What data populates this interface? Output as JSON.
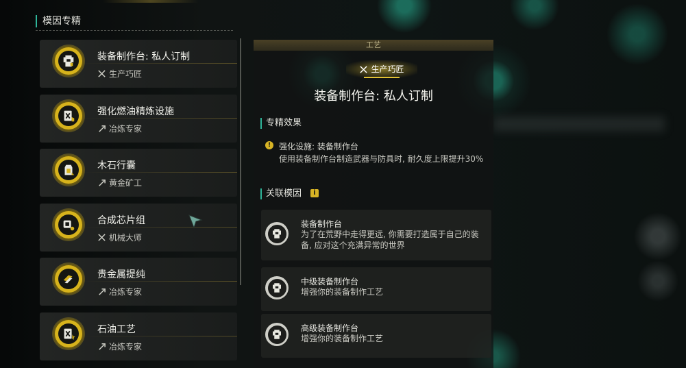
{
  "left_panel": {
    "title": "模因专精",
    "items": [
      {
        "name": "装备制作台: 私人订制",
        "category": "生产巧匠",
        "category_icon": "tools-icon",
        "item_icon": "workbench-icon"
      },
      {
        "name": "强化燃油精炼设施",
        "category": "冶炼专家",
        "category_icon": "pickaxe-icon",
        "item_icon": "fuel-icon"
      },
      {
        "name": "木石行囊",
        "category": "黄金矿工",
        "category_icon": "pickaxe-icon",
        "item_icon": "backpack-icon"
      },
      {
        "name": "合成芯片组",
        "category": "机械大师",
        "category_icon": "tools-icon",
        "item_icon": "chip-icon"
      },
      {
        "name": "贵金属提纯",
        "category": "冶炼专家",
        "category_icon": "pickaxe-icon",
        "item_icon": "ingot-icon"
      },
      {
        "name": "石油工艺",
        "category": "冶炼专家",
        "category_icon": "pickaxe-icon",
        "item_icon": "fuel-icon"
      }
    ]
  },
  "detail": {
    "header": "工艺",
    "badge": "生产巧匠",
    "title": "装备制作台: 私人订制",
    "effects_title": "专精效果",
    "effect_name": "强化设施: 装备制作台",
    "effect_desc": "使用装备制作台制造武器与防具时, 耐久度上限提升30%",
    "related_title": "关联模因",
    "related": [
      {
        "name": "装备制作台",
        "desc": "为了在荒野中走得更远, 你需要打造属于自己的装备, 应对这个充满异常的世界"
      },
      {
        "name": "中级装备制作台",
        "desc": "增强你的装备制作工艺"
      },
      {
        "name": "高级装备制作台",
        "desc": "增强你的装备制作工艺"
      }
    ]
  },
  "colors": {
    "accent_gold": "#d7b31c",
    "accent_teal": "#2fb59a"
  }
}
